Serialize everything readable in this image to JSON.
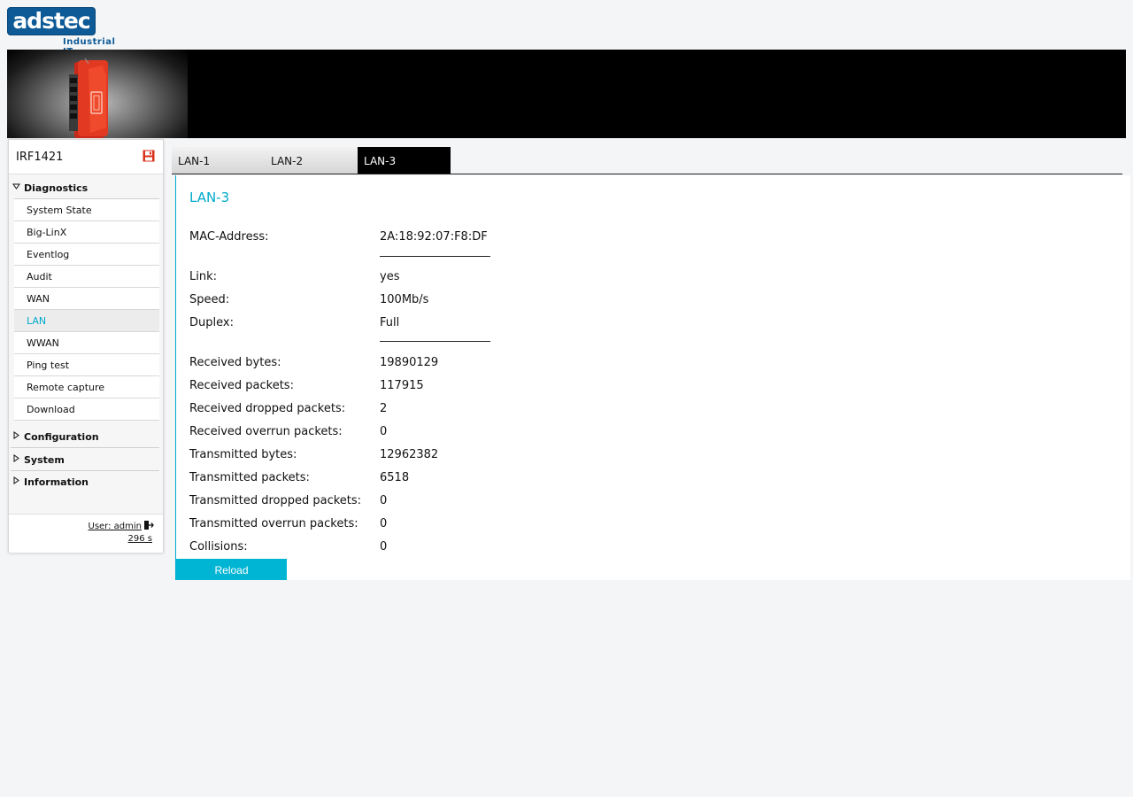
{
  "brand": {
    "logo_text": "adstec",
    "tagline": "Industrial IT"
  },
  "device": {
    "name": "IRF1421"
  },
  "sidebar": {
    "sections": [
      {
        "label": "Diagnostics",
        "expanded": true,
        "items": [
          {
            "label": "System State"
          },
          {
            "label": "Big-LinX"
          },
          {
            "label": "Eventlog"
          },
          {
            "label": "Audit"
          },
          {
            "label": "WAN"
          },
          {
            "label": "LAN",
            "active": true
          },
          {
            "label": "WWAN"
          },
          {
            "label": "Ping test"
          },
          {
            "label": "Remote capture"
          },
          {
            "label": "Download"
          }
        ]
      },
      {
        "label": "Configuration",
        "expanded": false
      },
      {
        "label": "System",
        "expanded": false
      },
      {
        "label": "Information",
        "expanded": false
      }
    ],
    "user_label": "User: admin",
    "session_timer": "296 s"
  },
  "tabs": [
    {
      "label": "LAN-1"
    },
    {
      "label": "LAN-2"
    },
    {
      "label": "LAN-3",
      "active": true
    }
  ],
  "main": {
    "title": "LAN-3",
    "mac": {
      "label": "MAC-Address:",
      "value": "2A:18:92:07:F8:DF"
    },
    "link": {
      "label": "Link:",
      "value": "yes"
    },
    "speed": {
      "label": "Speed:",
      "value": "100Mb/s"
    },
    "duplex": {
      "label": "Duplex:",
      "value": "Full"
    },
    "stats": [
      {
        "label": "Received bytes:",
        "value": "19890129"
      },
      {
        "label": "Received packets:",
        "value": "117915"
      },
      {
        "label": "Received dropped packets:",
        "value": "2"
      },
      {
        "label": "Received overrun packets:",
        "value": "0"
      },
      {
        "label": "Transmitted bytes:",
        "value": "12962382"
      },
      {
        "label": "Transmitted packets:",
        "value": "6518"
      },
      {
        "label": "Transmitted dropped packets:",
        "value": "0"
      },
      {
        "label": "Transmitted overrun packets:",
        "value": "0"
      },
      {
        "label": "Collisions:",
        "value": "0"
      }
    ],
    "reload_label": "Reload"
  },
  "colors": {
    "accent": "#00aacc",
    "button": "#00b4d4",
    "brand_blue": "#0d5a96",
    "device_red": "#d8321c"
  }
}
